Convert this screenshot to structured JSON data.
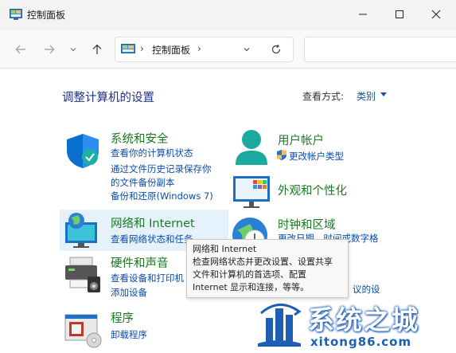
{
  "window": {
    "title": "控制面板"
  },
  "address": {
    "sep": "›",
    "path": "控制面板",
    "sep2": "›"
  },
  "view": {
    "heading": "调整计算机的设置",
    "view_by_label": "查看方式:",
    "view_by_value": "类别"
  },
  "categories": {
    "system_security": {
      "title": "系统和安全",
      "links": [
        "查看你的计算机状态",
        "通过文件历史记录保存你",
        "的文件备份副本",
        "备份和还原(Windows 7)"
      ]
    },
    "network": {
      "title": "网络和 Internet",
      "links": [
        "查看网络状态和任务"
      ]
    },
    "hardware": {
      "title": "硬件和声音",
      "links": [
        "查看设备和打印机",
        "添加设备"
      ]
    },
    "programs": {
      "title": "程序",
      "links": [
        "卸载程序"
      ]
    },
    "user_accounts": {
      "title": "用户帐户",
      "links": [
        "更改帐户类型"
      ]
    },
    "appearance": {
      "title": "外观和个性化",
      "links": []
    },
    "clock_region": {
      "title": "时钟和区域",
      "links": [
        "更改日期、时间或数字格"
      ]
    },
    "ease_partial": {
      "links": [
        "议的设"
      ]
    }
  },
  "tooltip": {
    "lines": [
      "网络和 Internet",
      "检查网络状态并更改设置、设置共享",
      "文件和计算机的首选项、配置",
      "Internet 显示和连接，等等。"
    ]
  },
  "watermark": {
    "title": "系统之城",
    "url": "xitong86.com"
  },
  "colors": {
    "heading": "#1e3287",
    "category_title": "#1a7a23",
    "link": "#0a4ea8",
    "hover": "#e5f1fb"
  }
}
